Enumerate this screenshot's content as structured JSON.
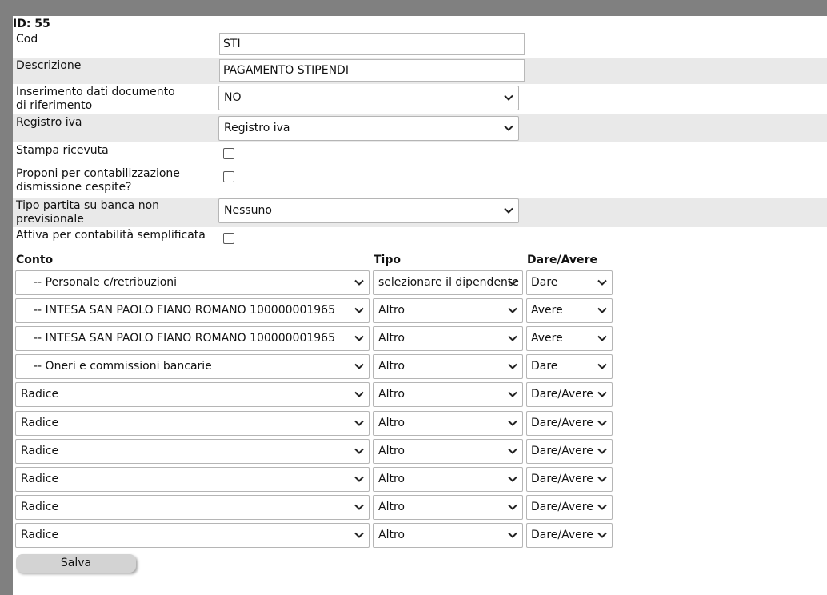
{
  "record": {
    "id_label": "ID: 55"
  },
  "fields": {
    "cod": {
      "label": "Cod",
      "value": "STI"
    },
    "descrizione": {
      "label": "Descrizione",
      "value": "PAGAMENTO STIPENDI"
    },
    "inserimento": {
      "label": "Inserimento dati documento di riferimento",
      "value": "NO"
    },
    "registro_iva": {
      "label": "Registro iva",
      "value": "Registro iva"
    },
    "stampa_ricevuta": {
      "label": "Stampa ricevuta",
      "checked": false
    },
    "proponi": {
      "label": "Proponi per contabilizzazione dismissione cespite?",
      "checked": false
    },
    "tipo_partita": {
      "label": "Tipo partita su banca non previsionale",
      "value": "Nessuno"
    },
    "attiva": {
      "label": "Attiva per contabilità semplificata",
      "checked": false
    }
  },
  "table": {
    "headers": {
      "conto": "Conto",
      "tipo": "Tipo",
      "dare_avere": "Dare/Avere"
    },
    "rows": [
      {
        "conto": "-- Personale c/retribuzioni",
        "tipo": "selezionare il dipendente",
        "dare_avere": "Dare"
      },
      {
        "conto": "-- INTESA SAN PAOLO FIANO ROMANO 100000001965",
        "tipo": "Altro",
        "dare_avere": "Avere"
      },
      {
        "conto": "-- INTESA SAN PAOLO FIANO ROMANO 100000001965",
        "tipo": "Altro",
        "dare_avere": "Avere"
      },
      {
        "conto": "-- Oneri e commissioni bancarie",
        "tipo": "Altro",
        "dare_avere": "Dare"
      },
      {
        "conto": "Radice",
        "tipo": "Altro",
        "dare_avere": "Dare/Avere"
      },
      {
        "conto": "Radice",
        "tipo": "Altro",
        "dare_avere": "Dare/Avere"
      },
      {
        "conto": "Radice",
        "tipo": "Altro",
        "dare_avere": "Dare/Avere"
      },
      {
        "conto": "Radice",
        "tipo": "Altro",
        "dare_avere": "Dare/Avere"
      },
      {
        "conto": "Radice",
        "tipo": "Altro",
        "dare_avere": "Dare/Avere"
      },
      {
        "conto": "Radice",
        "tipo": "Altro",
        "dare_avere": "Dare/Avere"
      }
    ]
  },
  "actions": {
    "save_label": "Salva"
  },
  "icons": {
    "dropdown": "chevron-down-icon",
    "checkbox": "checkbox-unchecked"
  }
}
